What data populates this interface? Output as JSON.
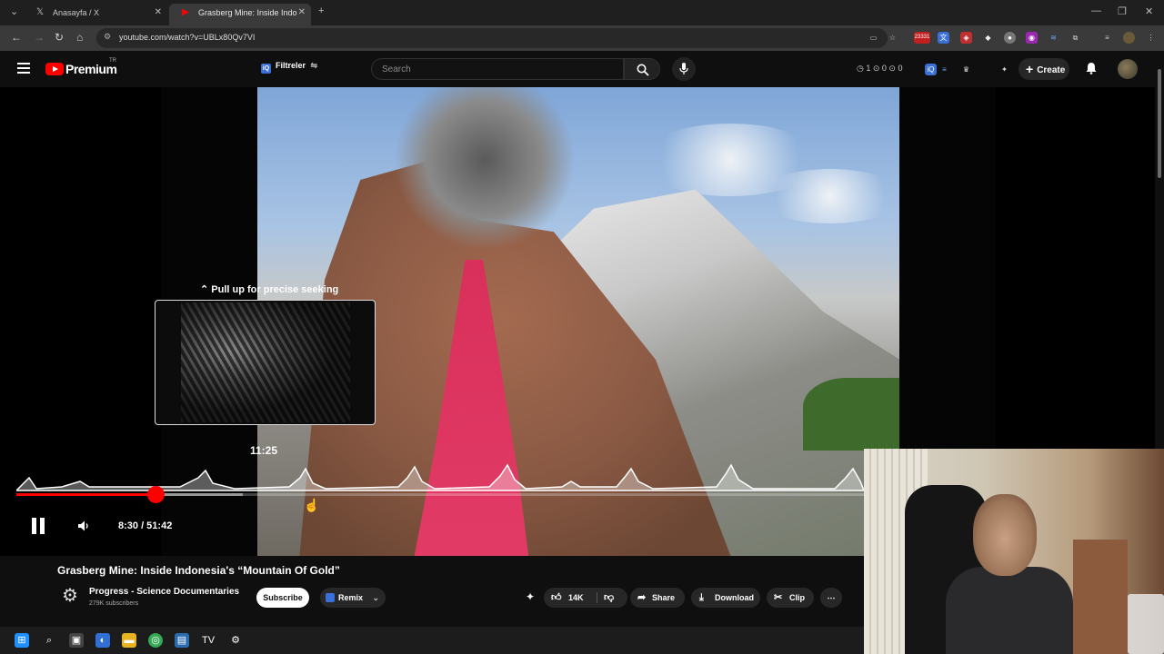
{
  "browser": {
    "tabs": [
      {
        "title": "Anasayfa / X",
        "icon": "x-logo-icon",
        "active": false
      },
      {
        "title": "Grasberg Mine: Inside Indo",
        "icon": "youtube-icon",
        "active": true
      }
    ],
    "url": "youtube.com/watch?v=UBLx80Qv7VI",
    "extension_badge": "23331"
  },
  "youtube": {
    "logo": "Premium",
    "region": "TR",
    "filter_label": "Filtreler",
    "search_placeholder": "Search",
    "counters": "◷ 1 ⊙ 0 ⊙ 0",
    "create_label": "Create"
  },
  "player": {
    "seek_hint": "Pull up for precise seeking",
    "preview_time": "11:25",
    "time_display": "8:30 / 51:42",
    "current_seconds": 510,
    "duration_seconds": 3102,
    "buffered_seconds": 830,
    "state": "playing",
    "accent_color": "#ff0000"
  },
  "video": {
    "title": "Grasberg Mine: Inside Indonesia's “Mountain Of Gold”",
    "channel": "Progress - Science Documentaries",
    "subscribers": "279K subscribers",
    "subscribe_label": "Subscribe",
    "remix_label": "Remix",
    "likes": "14K",
    "share_label": "Share",
    "download_label": "Download",
    "clip_label": "Clip"
  }
}
